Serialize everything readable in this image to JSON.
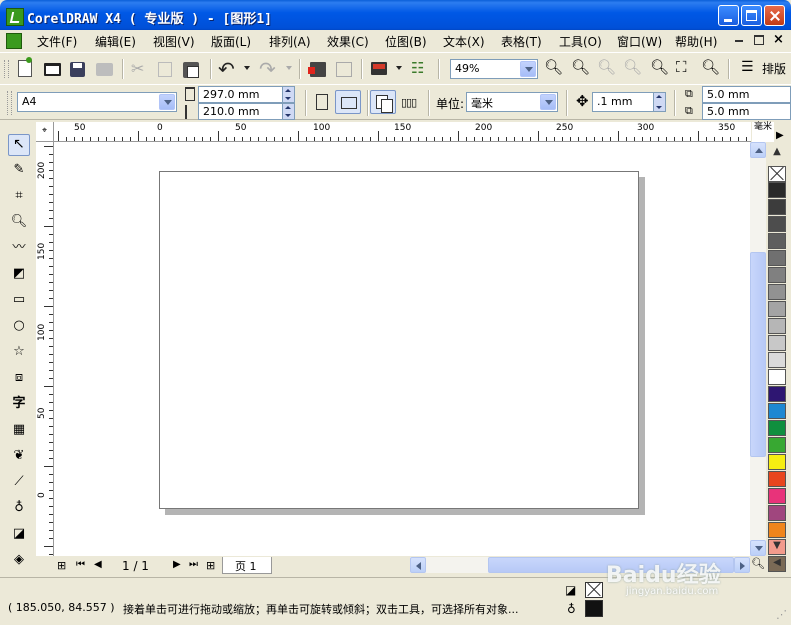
{
  "window": {
    "title": "CorelDRAW X4 ( 专业版 ) - [图形1]"
  },
  "menu": [
    {
      "label": "文件(F)"
    },
    {
      "label": "编辑(E)"
    },
    {
      "label": "视图(V)"
    },
    {
      "label": "版面(L)"
    },
    {
      "label": "排列(A)"
    },
    {
      "label": "效果(C)"
    },
    {
      "label": "位图(B)"
    },
    {
      "label": "文本(X)"
    },
    {
      "label": "表格(T)"
    },
    {
      "label": "工具(O)"
    },
    {
      "label": "窗口(W)"
    },
    {
      "label": "帮助(H)"
    }
  ],
  "toolbar": {
    "zoom_value": "49%",
    "layout_label": "排版"
  },
  "property_bar": {
    "page_size": "A4",
    "width": "297.0 mm",
    "height": "210.0 mm",
    "unit_label": "单位:",
    "unit_value": "毫米",
    "nudge": ".1 mm",
    "dup_x": "5.0 mm",
    "dup_y": "5.0 mm"
  },
  "ruler": {
    "unit": "毫米",
    "h_labels": [
      "50",
      "0",
      "50",
      "100",
      "150",
      "200",
      "250",
      "300",
      "350"
    ],
    "v_labels": [
      "200",
      "150",
      "100",
      "50",
      "0"
    ]
  },
  "page_nav": {
    "counter": "1 / 1",
    "tab": "页 1"
  },
  "status": {
    "coords": "( 185.050, 84.557 )",
    "hint": "接着单击可进行拖动或缩放；再单击可旋转或倾斜；双击工具，可选择所有对象..."
  },
  "palette": {
    "colors": [
      "#ffffff",
      "#2a2a2a",
      "#3c3c3c",
      "#4d4d4d",
      "#5e5e5e",
      "#707070",
      "#808080",
      "#929292",
      "#a4a4a4",
      "#b6b6b6",
      "#c8c8c8",
      "#dadada",
      "#ffffff",
      "#2e1672",
      "#1e88d2",
      "#0f8f3e",
      "#38a832",
      "#f6ee12",
      "#e8461e",
      "#e8337a",
      "#a0467e",
      "#f0851c",
      "#f29b8c",
      "#7a6a56"
    ]
  },
  "watermark": {
    "brand": "Baidu经验",
    "url": "jingyan.baidu.com"
  }
}
